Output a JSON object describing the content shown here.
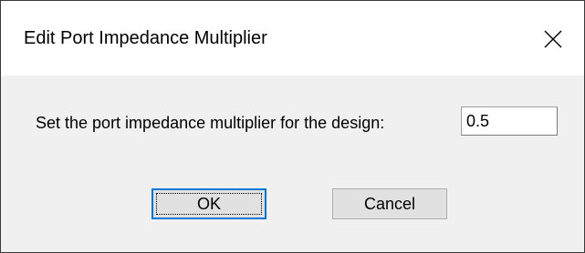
{
  "dialog": {
    "title": "Edit Port Impedance Multiplier",
    "close_icon": "close-icon",
    "prompt": "Set the port impedance multiplier for the design:",
    "multiplier_value": "0.5",
    "ok_label": "OK",
    "cancel_label": "Cancel"
  },
  "colors": {
    "title_bar": "#ffffff",
    "client_area": "#f0f0f0",
    "button_face": "#e1e1e1",
    "default_button_border": "#0078d7"
  }
}
